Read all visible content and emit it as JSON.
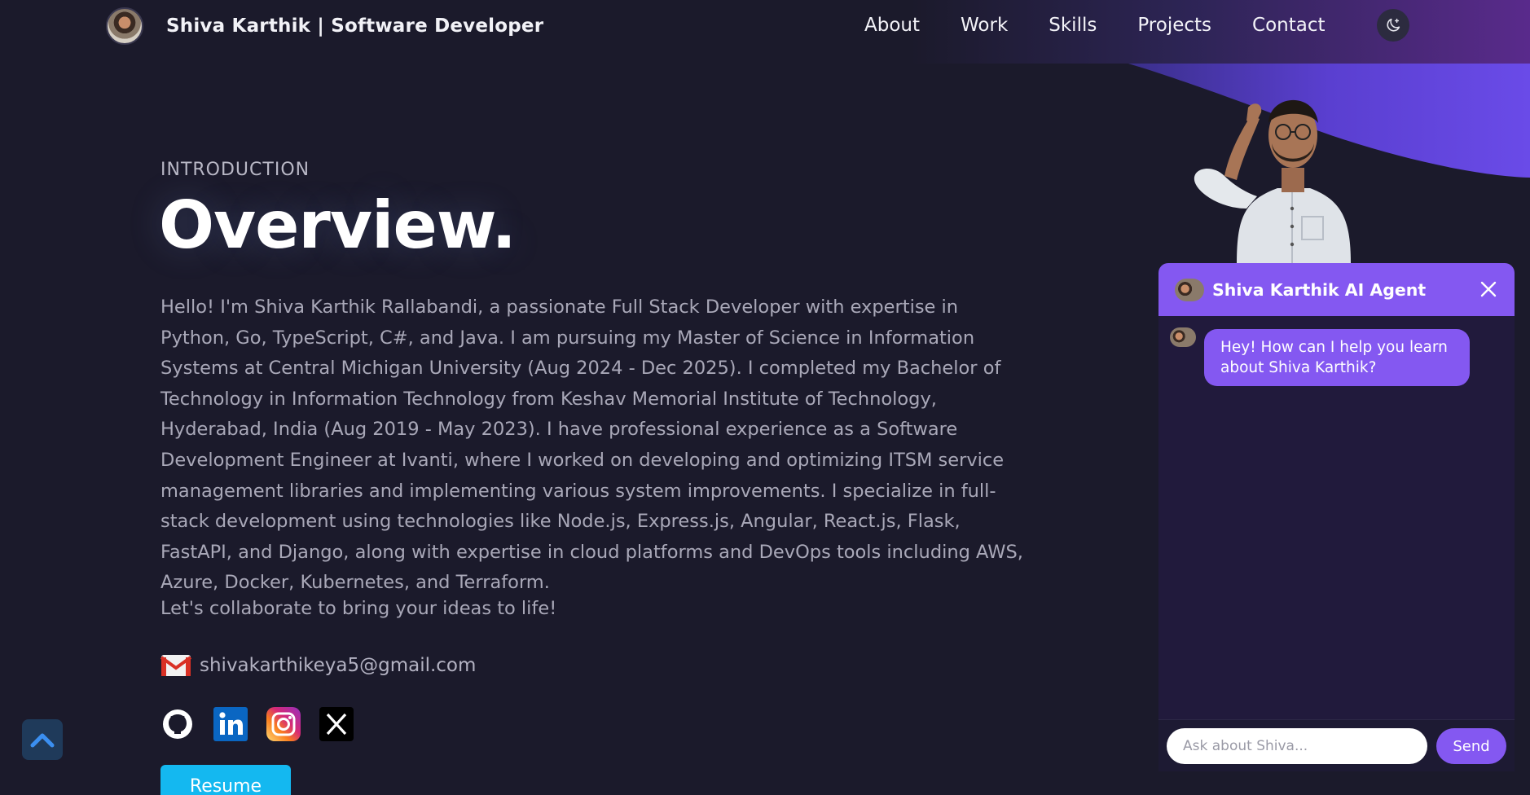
{
  "header": {
    "brand": "Shiva Karthik  | Software Developer",
    "nav": [
      "About",
      "Work",
      "Skills",
      "Projects",
      "Contact"
    ],
    "theme_toggle_icon": "moon-icon"
  },
  "overview": {
    "label": "INTRODUCTION",
    "title": "Overview.",
    "bio": "Hello! I'm Shiva Karthik Rallabandi, a passionate Full Stack Developer with expertise in Python, Go, TypeScript, C#, and Java. I am pursuing my Master of Science in Information Systems at Central Michigan University (Aug 2024 - Dec 2025). I completed my Bachelor of Technology in Information Technology from Keshav Memorial Institute of Technology, Hyderabad, India (Aug 2019 - May 2023). I have professional experience as a Software Development Engineer at Ivanti, where I worked on developing and optimizing ITSM service management libraries and implementing various system improvements. I specialize in full-stack development using technologies like Node.js, Express.js, Angular, React.js, Flask, FastAPI, and Django, along with expertise in cloud platforms and DevOps tools including AWS, Azure, Docker, Kubernetes, and Terraform.",
    "tagline": "Let's collaborate to bring your ideas to life!",
    "email": "shivakarthikeya5@gmail.com",
    "socials": [
      "github-icon",
      "linkedin-icon",
      "instagram-icon",
      "x-icon"
    ],
    "resume_label": "Resume"
  },
  "chat": {
    "title": "Shiva Karthik AI Agent",
    "greeting": "Hey! How can I help you learn about Shiva Karthik?",
    "input_placeholder": "Ask about Shiva...",
    "send_label": "Send"
  },
  "colors": {
    "background": "#1b1a2b",
    "accent_purple": "#8458f1",
    "resume_blue": "#14b8f0"
  }
}
